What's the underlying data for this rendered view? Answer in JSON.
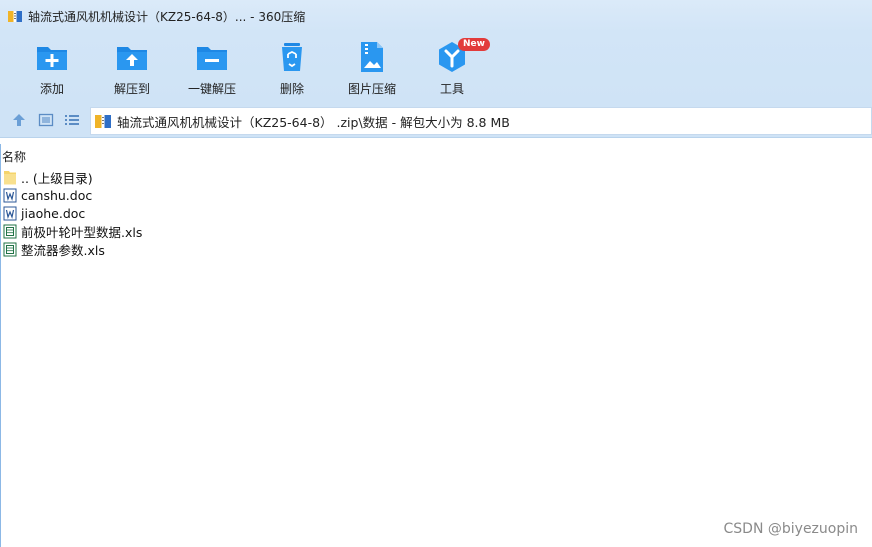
{
  "window": {
    "title": "轴流式通风机机械设计（KZ25-64-8）... - 360压缩"
  },
  "toolbar": {
    "items": [
      {
        "label": "添加",
        "icon": "add-folder-icon"
      },
      {
        "label": "解压到",
        "icon": "extract-to-icon"
      },
      {
        "label": "一键解压",
        "icon": "one-click-extract-icon"
      },
      {
        "label": "删除",
        "icon": "recycle-delete-icon"
      },
      {
        "label": "图片压缩",
        "icon": "image-compress-icon"
      },
      {
        "label": "工具",
        "icon": "tools-icon",
        "badge": "New"
      }
    ]
  },
  "address": {
    "path": "轴流式通风机机械设计（KZ25-64-8） .zip\\数据 - 解包大小为 8.8 MB"
  },
  "list": {
    "column_name": "名称",
    "files": [
      {
        "name": ".. (上级目录)",
        "type": "folder"
      },
      {
        "name": "canshu.doc",
        "type": "doc"
      },
      {
        "name": "jiaohe.doc",
        "type": "doc"
      },
      {
        "name": "前极叶轮叶型数据.xls",
        "type": "xls"
      },
      {
        "name": "整流器参数.xls",
        "type": "xls"
      }
    ]
  },
  "watermark": "CSDN @biyezuopin",
  "colors": {
    "accent": "#1e88e5",
    "toolbar_bg": "#d2e5f7",
    "badge": "#e23b3b"
  }
}
